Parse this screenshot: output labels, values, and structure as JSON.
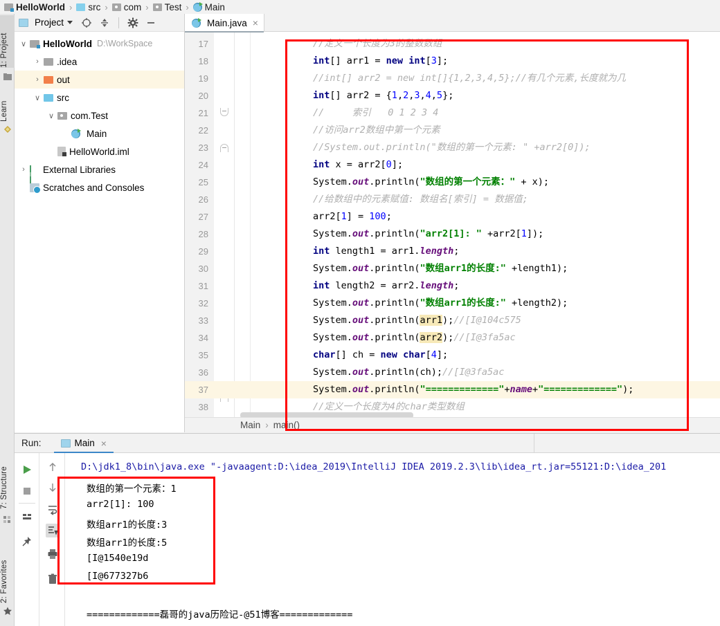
{
  "breadcrumb": {
    "items": [
      {
        "label": "HelloWorld",
        "icon": "module-icon",
        "bold": true
      },
      {
        "label": "src",
        "icon": "source-folder-icon",
        "bold": false
      },
      {
        "label": "com",
        "icon": "package-icon",
        "bold": false
      },
      {
        "label": "Test",
        "icon": "package-icon",
        "bold": false
      },
      {
        "label": "Main",
        "icon": "java-class-icon",
        "bold": false
      }
    ],
    "separator": "›"
  },
  "toolstrip": {
    "left_top": [
      {
        "label": "1: Project",
        "selected": true,
        "icon": "project-icon"
      },
      {
        "label": "Learn",
        "selected": false,
        "icon": "learn-icon"
      }
    ],
    "left_bottom": [
      {
        "label": "7: Structure",
        "selected": false,
        "icon": "structure-icon"
      },
      {
        "label": "2: Favorites",
        "selected": false,
        "icon": "star-icon"
      }
    ]
  },
  "project_panel": {
    "title": "Project",
    "toolbar_icons": [
      "locate-icon",
      "collapse-all-icon",
      "settings-gear-icon",
      "hide-minimize-icon"
    ],
    "tree": [
      {
        "label": "HelloWorld",
        "path": "D:\\WorkSpace",
        "icon": "module-folder-icon",
        "arrow": "∨",
        "indent": 0,
        "bold": true,
        "highlight": false
      },
      {
        "label": ".idea",
        "path": "",
        "icon": "folder-gray-icon",
        "arrow": "›",
        "indent": 1,
        "bold": false,
        "highlight": false
      },
      {
        "label": "out",
        "path": "",
        "icon": "folder-orange-icon",
        "arrow": "›",
        "indent": 1,
        "bold": false,
        "highlight": true
      },
      {
        "label": "src",
        "path": "",
        "icon": "folder-blue-icon",
        "arrow": "∨",
        "indent": 1,
        "bold": false,
        "highlight": false
      },
      {
        "label": "com.Test",
        "path": "",
        "icon": "package-icon",
        "arrow": "∨",
        "indent": 2,
        "bold": false,
        "highlight": false
      },
      {
        "label": "Main",
        "path": "",
        "icon": "java-class-icon",
        "arrow": "",
        "indent": 3,
        "bold": false,
        "highlight": false
      },
      {
        "label": "HelloWorld.iml",
        "path": "",
        "icon": "iml-file-icon",
        "arrow": "",
        "indent": 2,
        "bold": false,
        "highlight": false
      },
      {
        "label": "External Libraries",
        "path": "",
        "icon": "libraries-icon",
        "arrow": "›",
        "indent": 0,
        "bold": false,
        "highlight": false
      },
      {
        "label": "Scratches and Consoles",
        "path": "",
        "icon": "scratches-icon",
        "arrow": "",
        "indent": 0,
        "bold": false,
        "highlight": false
      }
    ]
  },
  "editor": {
    "tab": {
      "label": "Main.java",
      "icon": "java-class-icon",
      "close": "×"
    },
    "breadcrumb": {
      "class": "Main",
      "method": "main()",
      "separator": "›"
    },
    "first_line_number": 17,
    "current_line": 37,
    "lines": [
      {
        "n": 17,
        "tokens": [
          {
            "t": "cmt",
            "s": "//定义一个长度为3的整数数组"
          }
        ]
      },
      {
        "n": 18,
        "tokens": [
          {
            "t": "kw",
            "s": "int"
          },
          {
            "t": "plain",
            "s": "[] arr1 = "
          },
          {
            "t": "kw",
            "s": "new "
          },
          {
            "t": "kw",
            "s": "int"
          },
          {
            "t": "plain",
            "s": "["
          },
          {
            "t": "num",
            "s": "3"
          },
          {
            "t": "plain",
            "s": "];"
          }
        ]
      },
      {
        "n": 19,
        "tokens": [
          {
            "t": "cmt",
            "s": "//int[] arr2 = new int[]{1,2,3,4,5};//有几个元素,长度就为几"
          }
        ]
      },
      {
        "n": 20,
        "tokens": [
          {
            "t": "kw",
            "s": "int"
          },
          {
            "t": "plain",
            "s": "[] arr2 = {"
          },
          {
            "t": "num",
            "s": "1"
          },
          {
            "t": "plain",
            "s": ","
          },
          {
            "t": "num",
            "s": "2"
          },
          {
            "t": "plain",
            "s": ","
          },
          {
            "t": "num",
            "s": "3"
          },
          {
            "t": "plain",
            "s": ","
          },
          {
            "t": "num",
            "s": "4"
          },
          {
            "t": "plain",
            "s": ","
          },
          {
            "t": "num",
            "s": "5"
          },
          {
            "t": "plain",
            "s": "};"
          }
        ]
      },
      {
        "n": 21,
        "tokens": [
          {
            "t": "cmt",
            "s": "//     索引   0 1 2 3 4"
          }
        ]
      },
      {
        "n": 22,
        "tokens": [
          {
            "t": "cmt",
            "s": "//访问arr2数组中第一个元素"
          }
        ]
      },
      {
        "n": 23,
        "tokens": [
          {
            "t": "cmt",
            "s": "//System.out.println(\"数组的第一个元素: \" +arr2[0]);"
          }
        ]
      },
      {
        "n": 24,
        "tokens": [
          {
            "t": "kw",
            "s": "int"
          },
          {
            "t": "plain",
            "s": " x = arr2["
          },
          {
            "t": "num",
            "s": "0"
          },
          {
            "t": "plain",
            "s": "];"
          }
        ]
      },
      {
        "n": 25,
        "tokens": [
          {
            "t": "plain",
            "s": "System."
          },
          {
            "t": "fld",
            "s": "out"
          },
          {
            "t": "plain",
            "s": ".println("
          },
          {
            "t": "str",
            "s": "\"数组的第一个元素：\""
          },
          {
            "t": "plain",
            "s": " + x);"
          }
        ]
      },
      {
        "n": 26,
        "tokens": [
          {
            "t": "cmt",
            "s": "//给数组中的元素赋值: 数组名[索引] = 数据值;"
          }
        ]
      },
      {
        "n": 27,
        "tokens": [
          {
            "t": "plain",
            "s": "arr2["
          },
          {
            "t": "num",
            "s": "1"
          },
          {
            "t": "plain",
            "s": "] = "
          },
          {
            "t": "num",
            "s": "100"
          },
          {
            "t": "plain",
            "s": ";"
          }
        ]
      },
      {
        "n": 28,
        "tokens": [
          {
            "t": "plain",
            "s": "System."
          },
          {
            "t": "fld",
            "s": "out"
          },
          {
            "t": "plain",
            "s": ".println("
          },
          {
            "t": "str",
            "s": "\"arr2[1]: \""
          },
          {
            "t": "plain",
            "s": " +arr2["
          },
          {
            "t": "num",
            "s": "1"
          },
          {
            "t": "plain",
            "s": "]);"
          }
        ]
      },
      {
        "n": 29,
        "tokens": [
          {
            "t": "kw",
            "s": "int"
          },
          {
            "t": "plain",
            "s": " length1 = arr1."
          },
          {
            "t": "fld2",
            "s": "length"
          },
          {
            "t": "plain",
            "s": ";"
          }
        ]
      },
      {
        "n": 30,
        "tokens": [
          {
            "t": "plain",
            "s": "System."
          },
          {
            "t": "fld",
            "s": "out"
          },
          {
            "t": "plain",
            "s": ".println("
          },
          {
            "t": "str",
            "s": "\"数组arr1的长度:\""
          },
          {
            "t": "plain",
            "s": " +length1);"
          }
        ]
      },
      {
        "n": 31,
        "tokens": [
          {
            "t": "kw",
            "s": "int"
          },
          {
            "t": "plain",
            "s": " length2 = arr2."
          },
          {
            "t": "fld2",
            "s": "length"
          },
          {
            "t": "plain",
            "s": ";"
          }
        ]
      },
      {
        "n": 32,
        "tokens": [
          {
            "t": "plain",
            "s": "System."
          },
          {
            "t": "fld",
            "s": "out"
          },
          {
            "t": "plain",
            "s": ".println("
          },
          {
            "t": "str",
            "s": "\"数组arr1的长度:\""
          },
          {
            "t": "plain",
            "s": " +length2);"
          }
        ]
      },
      {
        "n": 33,
        "tokens": [
          {
            "t": "plain",
            "s": "System."
          },
          {
            "t": "fld",
            "s": "out"
          },
          {
            "t": "plain",
            "s": ".println("
          },
          {
            "t": "hl",
            "s": "arr1"
          },
          {
            "t": "plain",
            "s": ");"
          },
          {
            "t": "cmt",
            "s": "//[I@104c575"
          }
        ]
      },
      {
        "n": 34,
        "tokens": [
          {
            "t": "plain",
            "s": "System."
          },
          {
            "t": "fld",
            "s": "out"
          },
          {
            "t": "plain",
            "s": ".println("
          },
          {
            "t": "hl",
            "s": "arr2"
          },
          {
            "t": "plain",
            "s": ");"
          },
          {
            "t": "cmt",
            "s": "//[I@3fa5ac"
          }
        ]
      },
      {
        "n": 35,
        "tokens": [
          {
            "t": "kw",
            "s": "char"
          },
          {
            "t": "plain",
            "s": "[] ch = "
          },
          {
            "t": "kw",
            "s": "new "
          },
          {
            "t": "kw",
            "s": "char"
          },
          {
            "t": "plain",
            "s": "["
          },
          {
            "t": "num",
            "s": "4"
          },
          {
            "t": "plain",
            "s": "];"
          }
        ]
      },
      {
        "n": 36,
        "tokens": [
          {
            "t": "plain",
            "s": "System."
          },
          {
            "t": "fld",
            "s": "out"
          },
          {
            "t": "plain",
            "s": ".println(ch);"
          },
          {
            "t": "cmt",
            "s": "//[I@3fa5ac"
          }
        ]
      },
      {
        "n": 37,
        "tokens": [
          {
            "t": "plain",
            "s": "System."
          },
          {
            "t": "fld",
            "s": "out"
          },
          {
            "t": "plain",
            "s": ".println("
          },
          {
            "t": "str",
            "s": "\"=============\""
          },
          {
            "t": "plain",
            "s": "+"
          },
          {
            "t": "fld",
            "s": "name"
          },
          {
            "t": "plain",
            "s": "+"
          },
          {
            "t": "str",
            "s": "\"=============\""
          },
          {
            "t": "plain",
            "s": ");"
          }
        ]
      }
    ]
  },
  "run_panel": {
    "label": "Run:",
    "tab": {
      "label": "Main",
      "icon": "run-config-icon",
      "close": "×"
    },
    "side_buttons": [
      "run-icon",
      "stop-icon",
      "layout-icon",
      "pin-icon"
    ],
    "side_buttons2": [
      "scroll-up-icon",
      "scroll-down-icon",
      "soft-wrap-icon",
      "scroll-to-end-icon",
      "print-icon",
      "clear-all-icon"
    ],
    "console": [
      "D:\\jdk1_8\\bin\\java.exe \"-javaagent:D:\\idea_2019\\IntelliJ IDEA 2019.2.3\\lib\\idea_rt.jar=55121:D:\\idea_201",
      "数组的第一个元素：1",
      "arr2[1]: 100",
      "数组arr1的长度:3",
      "数组arr1的长度:5",
      "[I@1540e19d",
      "[I@677327b6",
      "",
      "=============磊哥的java历险记-@51博客============="
    ]
  },
  "colors": {
    "keyword": "#000080",
    "string": "#008000",
    "number": "#0000ff",
    "comment": "#b0b0b0",
    "field": "#660e7a",
    "annotation_box": "#ff0000",
    "current_line": "#fdf6e3",
    "tab_underline": "#3c87c9"
  }
}
